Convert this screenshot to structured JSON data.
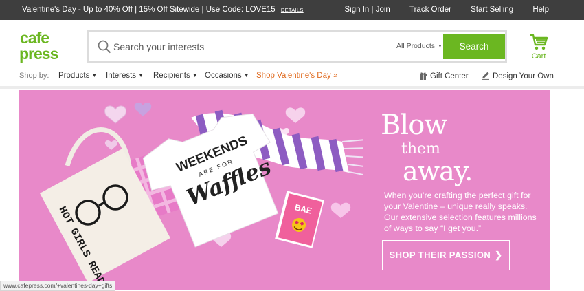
{
  "topbar": {
    "promo": "Valentine's Day - Up to 40% Off | 15% Off Sitewide | Use Code: LOVE15",
    "details": "DETAILS",
    "links": [
      "Sign In | Join",
      "Track Order",
      "Start Selling",
      "Help"
    ]
  },
  "brand": {
    "logo_line1": "cafe",
    "logo_line2": "press",
    "color": "#6bb721"
  },
  "search": {
    "placeholder": "Search your interests",
    "scope": "All Products",
    "button": "Search"
  },
  "cart": {
    "label": "Cart"
  },
  "nav": {
    "shop_by": "Shop by:",
    "items": [
      "Products",
      "Interests",
      "Recipients",
      "Occasions"
    ],
    "valentine": "Shop Valentine's Day »",
    "gift_center": "Gift Center",
    "design": "Design Your Own"
  },
  "hero": {
    "headline_1": "Blow",
    "headline_2": "them",
    "headline_3": "away.",
    "copy": "When you’re crafting the perfect gift for your Valentine – unique really speaks. Our extensive selection features millions of ways to say “I get you.”",
    "cta": "SHOP THEIR PASSION",
    "tote_text": "HOT GIRLS READ.",
    "shirt_text_1": "WEEKENDS",
    "shirt_text_2": "ARE FOR",
    "shirt_text_3": "Waffles",
    "card_text": "BAE",
    "background": "#e889c9"
  },
  "status": {
    "url": "www.cafepress.com/+valentines-day+gifts"
  }
}
